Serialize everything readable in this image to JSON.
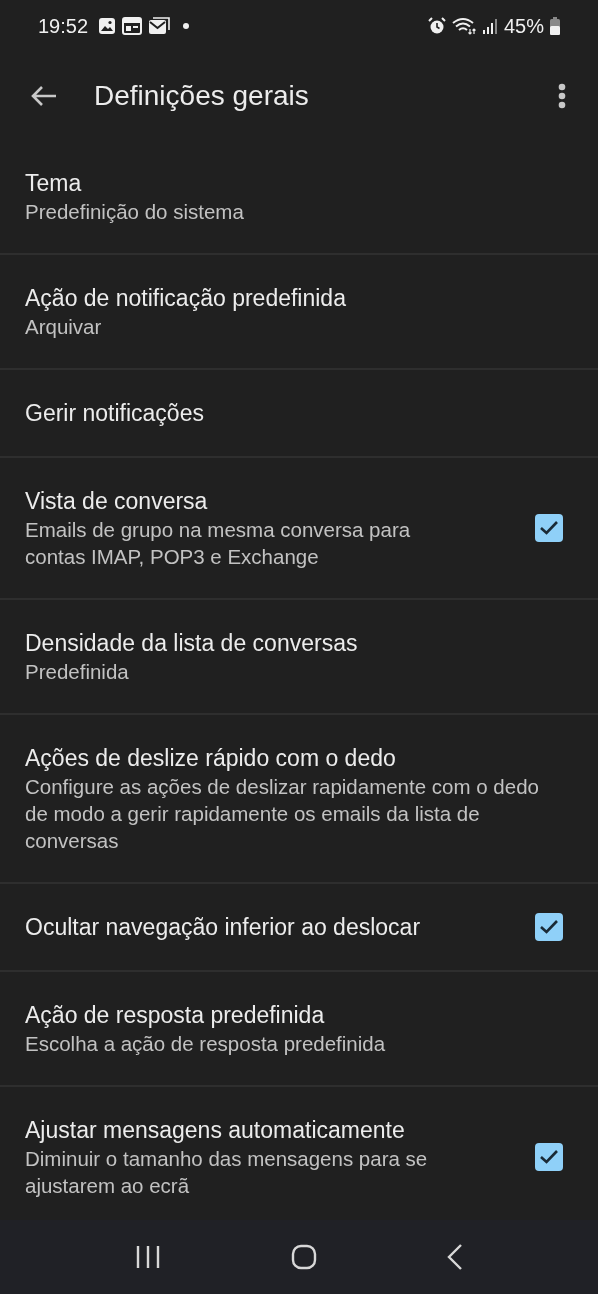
{
  "status_bar": {
    "time": "19:52",
    "battery": "45%"
  },
  "toolbar": {
    "title": "Definições gerais"
  },
  "settings": [
    {
      "kind": "plain",
      "title": "Tema",
      "subtitle": "Predefinição do sistema"
    },
    {
      "kind": "plain",
      "title": "Ação de notificação predefinida",
      "subtitle": "Arquivar"
    },
    {
      "kind": "plain",
      "title": "Gerir notificações"
    },
    {
      "kind": "checkbox",
      "title": "Vista de conversa",
      "subtitle": "Emails de grupo na mesma conversa para contas IMAP, POP3 e Exchange",
      "checked": true
    },
    {
      "kind": "plain",
      "title": "Densidade da lista de conversas",
      "subtitle": "Predefinida"
    },
    {
      "kind": "plain",
      "title": "Ações de deslize rápido com o dedo",
      "subtitle": "Configure as ações de deslizar rapidamente com o dedo de modo a gerir rapidamente os emails da lista de conversas"
    },
    {
      "kind": "checkbox",
      "title": "Ocultar navegação inferior ao deslocar",
      "checked": true
    },
    {
      "kind": "plain",
      "title": "Ação de resposta predefinida",
      "subtitle": "Escolha a ação de resposta predefinida"
    },
    {
      "kind": "checkbox",
      "title": "Ajustar mensagens automaticamente",
      "subtitle": "Diminuir o tamanho das mensagens para se ajustarem ao ecrã",
      "checked": true
    }
  ]
}
